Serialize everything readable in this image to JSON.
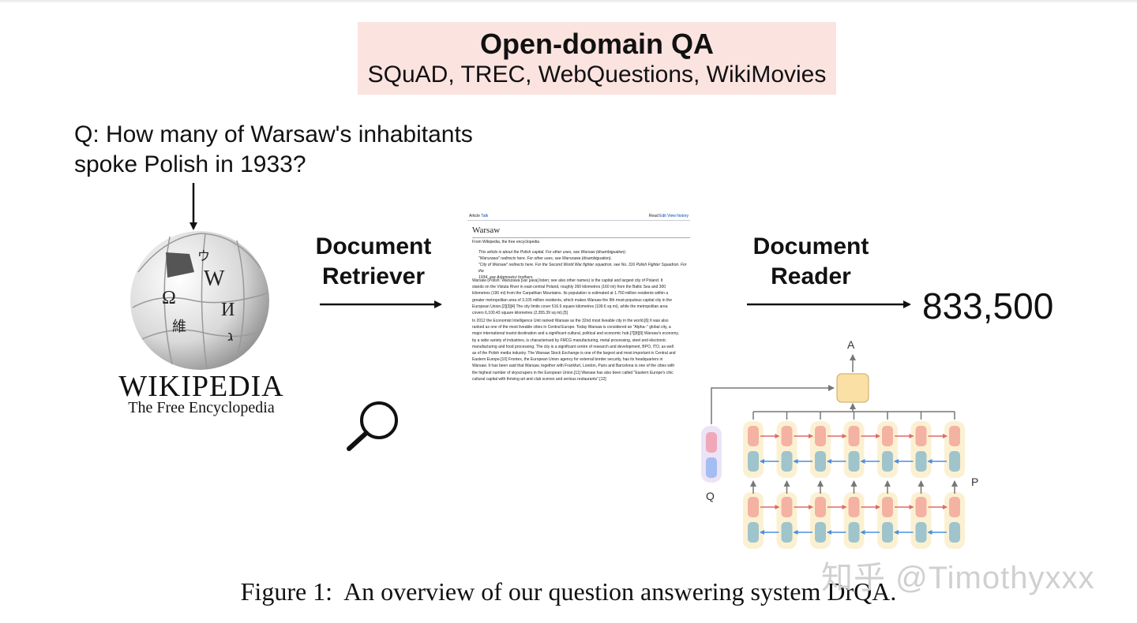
{
  "header": {
    "title": "Open-domain QA",
    "datasets": "SQuAD, TREC, WebQuestions, WikiMovies"
  },
  "question": {
    "line1": "Q:  How many of Warsaw's inhabitants",
    "line2": "spoke Polish in 1933?"
  },
  "wikipedia": {
    "wordmark": "WIKIPEDIA",
    "tagline": "The Free Encyclopedia",
    "glyphs": [
      "W",
      "Ω",
      "И",
      "維",
      "ウ",
      "ג"
    ]
  },
  "retriever": {
    "line1": "Document",
    "line2": "Retriever"
  },
  "reader": {
    "line1": "Document",
    "line2": "Reader"
  },
  "answer": "833,500",
  "article": {
    "tab_article": "Article",
    "tab_talk": "Talk",
    "tab_read": "Read",
    "tab_edit": "Edit",
    "tab_history": "View history",
    "title": "Warsaw",
    "from": "From Wikipedia, the free encyclopedia",
    "hatnotes": [
      "This article is about the Polish capital. For other uses, see Warsaw (disambiguation).",
      "\"Warszawa\" redirects here. For other uses, see Warszawa (disambiguation).",
      "\"City of Warsaw\" redirects here. For the Second World War fighter squadron, see No. 316 Polish Fighter Squadron. For the",
      "1934, see Adamowicz brothers."
    ],
    "para1": [
      "Warsaw (Polish: Warszawa [varˈʂava] listen; see also other names) is the capital and largest city of Poland. It",
      "stands on the Vistula River in east-central Poland, roughly 260 kilometres (160 mi) from the Baltic Sea and 300",
      "kilometres (190 mi) from the Carpathian Mountains. Its population is estimated at 1.750 million residents within a",
      "greater metropolitan area of 3.105 million residents, which makes Warsaw the 9th most-populous capital city in the",
      "European Union.[2][3][4] The city limits cover 516.9 square kilometres (199.6 sq mi), while the metropolitan area",
      "covers 6,100.43 square kilometres (2,355.39 sq mi).[5]"
    ],
    "para2": [
      "In 2012 the Economist Intelligence Unit ranked Warsaw as the 32nd most liveable city in the world.[6] It was also",
      "ranked as one of the most liveable cities in Central Europe. Today Warsaw is considered an \"Alpha–\" global city, a",
      "major international tourist destination and a significant cultural, political and economic hub.[7][8][9] Warsaw's economy,",
      "by a wide variety of industries, is characterised by FMCG manufacturing, metal processing, steel and electronic",
      "manufacturing and food processing. The city is a significant centre of research and development, BPO, ITO, as well",
      "as of the Polish media industry. The Warsaw Stock Exchange is one of the largest and most important in Central and",
      "Eastern Europe.[10] Frontex, the European Union agency for external border security, has its headquarters in",
      "Warsaw. It has been said that Warsaw, together with Frankfurt, London, Paris and Barcelona is one of the cities with",
      "the highest number of skyscrapers in the European Union.[11] Warsaw has also been called \"Eastern Europe's chic",
      "cultural capital with thriving art and club scenes and serious restaurants\".[12]"
    ]
  },
  "reader_diagram": {
    "label_a": "A",
    "label_q": "Q",
    "label_p": "P",
    "columns": 7,
    "colors": {
      "highlight": "#fbf1d2",
      "forward_cell": "#f4b2a3",
      "backward_cell": "#9fc4cb",
      "forward_arrow": "#e06a6a",
      "backward_arrow": "#4a8fe0",
      "output_cell": "#fbe0a6",
      "q_highlight": "#ece4f6",
      "q_top": "#f0a8b8",
      "q_bottom": "#a4bdf3"
    }
  },
  "caption": {
    "figure": "Figure 1:",
    "text": "An overview of our question answering system DrQA."
  },
  "watermark": "知乎 @Timothyxxx"
}
